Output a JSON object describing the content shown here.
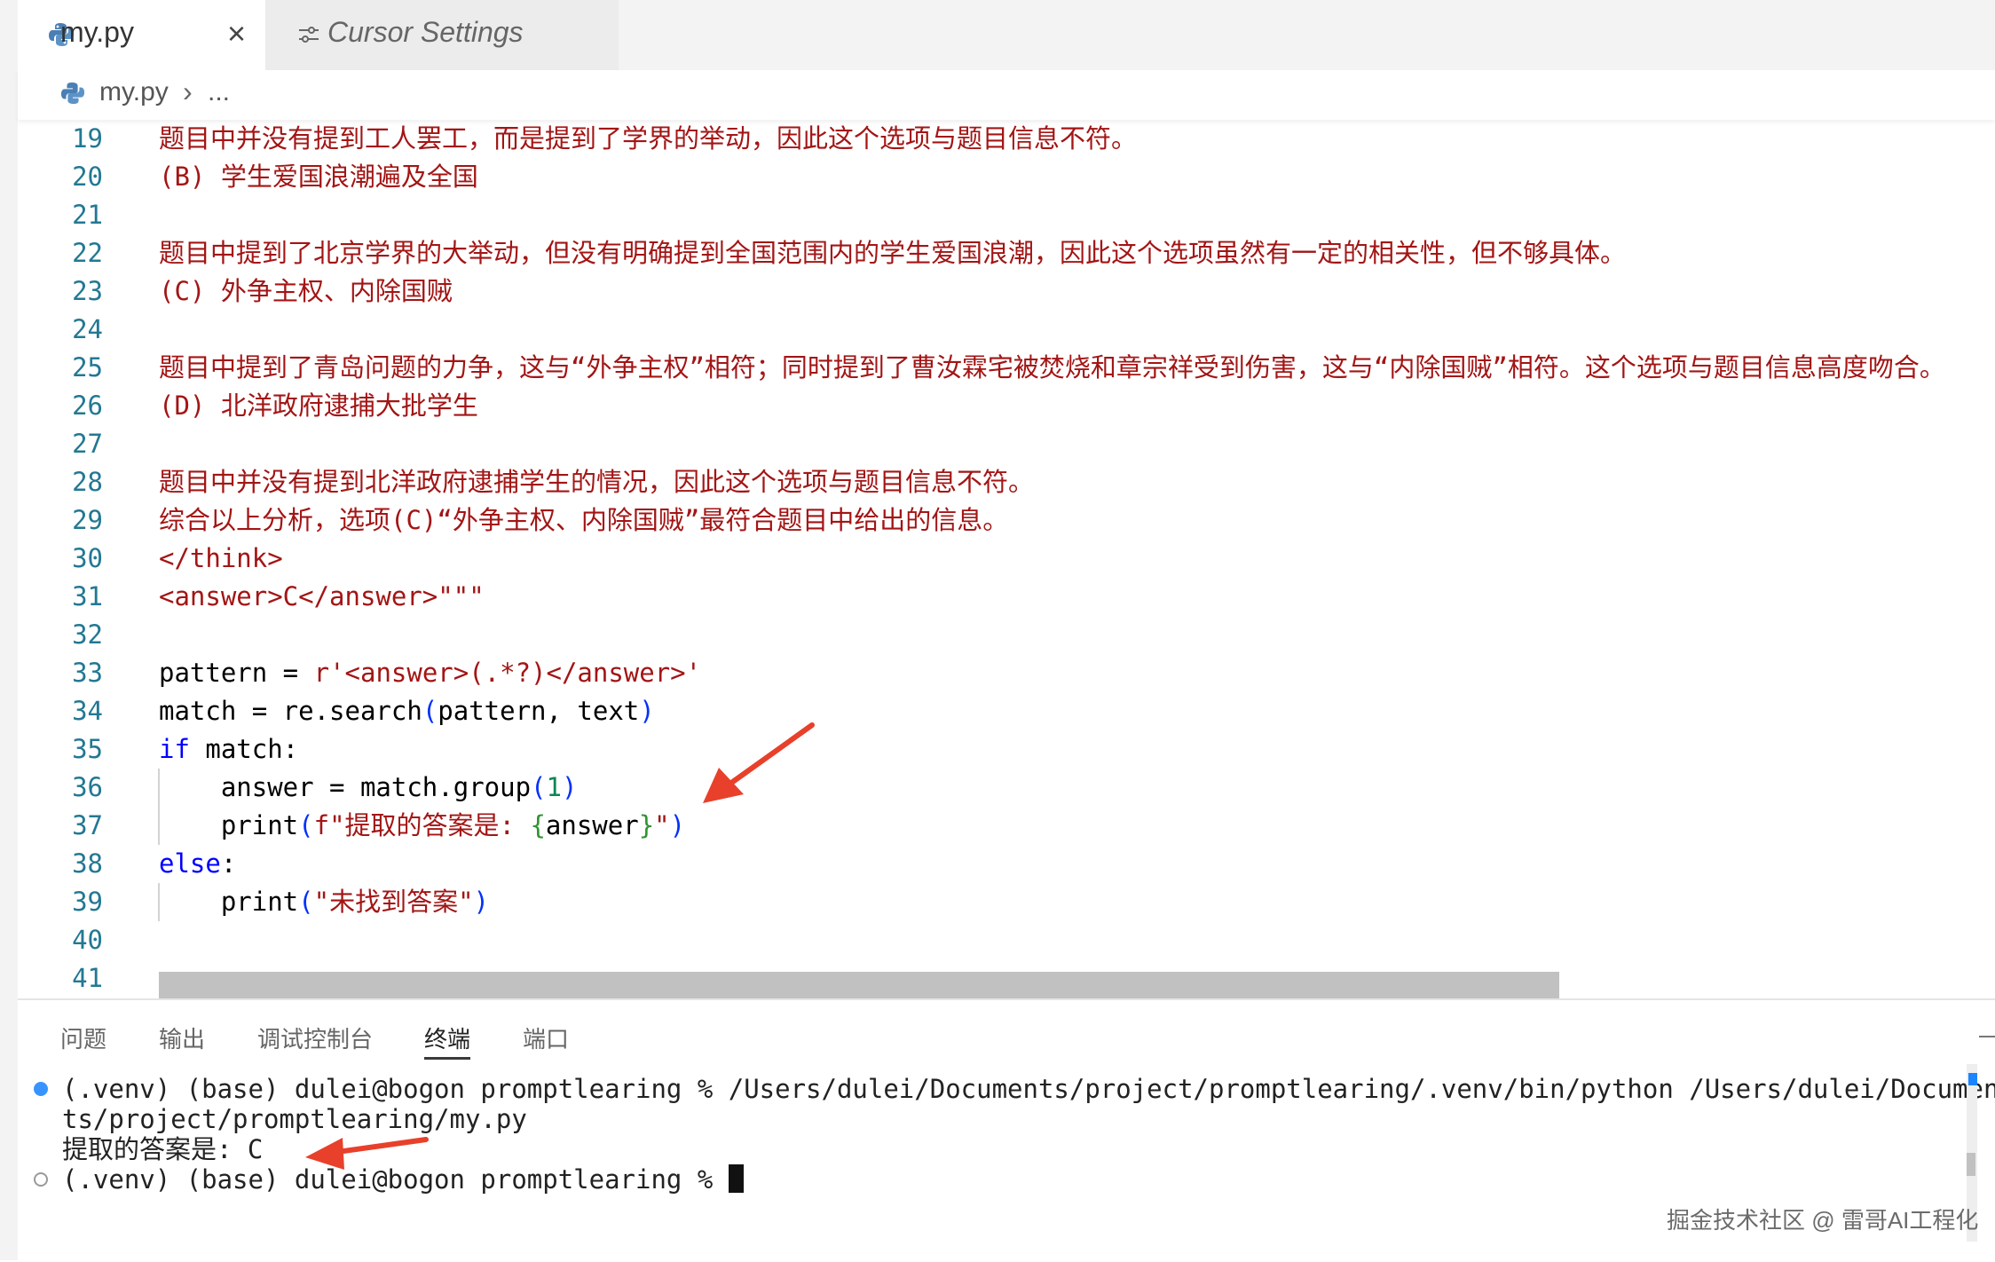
{
  "tabs": [
    {
      "label": "my.py",
      "close": "×",
      "icon": "python-icon"
    },
    {
      "label": "Cursor Settings",
      "icon": "settings-sliders-icon"
    }
  ],
  "breadcrumb": {
    "file": "my.py",
    "separator": "›",
    "more": "..."
  },
  "editor": {
    "lines": [
      {
        "n": "19"
      },
      {
        "n": "20"
      },
      {
        "n": "21"
      },
      {
        "n": "22"
      },
      {
        "n": "23"
      },
      {
        "n": "24"
      },
      {
        "n": "25"
      },
      {
        "n": "26"
      },
      {
        "n": "27"
      },
      {
        "n": "28"
      },
      {
        "n": "29"
      },
      {
        "n": "30"
      },
      {
        "n": "31"
      },
      {
        "n": "32"
      },
      {
        "n": "33"
      },
      {
        "n": "34"
      },
      {
        "n": "35"
      },
      {
        "n": "36"
      },
      {
        "n": "37"
      },
      {
        "n": "38"
      },
      {
        "n": "39"
      },
      {
        "n": "40"
      },
      {
        "n": "41"
      }
    ],
    "text": {
      "l19": "题目中并没有提到工人罢工，而是提到了学界的举动，因此这个选项与题目信息不符。",
      "l20": "(B) 学生爱国浪潮遍及全国",
      "l22": "题目中提到了北京学界的大举动，但没有明确提到全国范围内的学生爱国浪潮，因此这个选项虽然有一定的相关性，但不够具体。",
      "l23": "(C) 外争主权、内除国贼",
      "l25": "题目中提到了青岛问题的力争，这与“外争主权”相符；同时提到了曹汝霖宅被焚烧和章宗祥受到伤害，这与“内除国贼”相符。这个选项与题目信息高度吻合。",
      "l26": "(D) 北洋政府逮捕大批学生",
      "l28": "题目中并没有提到北洋政府逮捕学生的情况，因此这个选项与题目信息不符。",
      "l29": "综合以上分析，选项(C)“外争主权、内除国贼”最符合题目中给出的信息。",
      "l30": "</think>",
      "l31": "<answer>C</answer>\"\"\"",
      "l33a": "pattern",
      "l33b": " = ",
      "l33c": "r'<answer>(.*?)</answer>'",
      "l34a": "match = re.search",
      "l34b": "(",
      "l34c": "pattern, text",
      "l34d": ")",
      "l35a": "if",
      "l35b": " match:",
      "l36a": "    answer = match.group",
      "l36b": "(",
      "l36c": "1",
      "l36d": ")",
      "l37a": "    print",
      "l37b": "(",
      "l37c": "f\"提取的答案是: ",
      "l37d": "{",
      "l37e": "answer",
      "l37f": "}",
      "l37g": "\"",
      "l37h": ")",
      "l38a": "else",
      "l38b": ":",
      "l39a": "    print",
      "l39b": "(",
      "l39c": "\"未找到答案\"",
      "l39d": ")"
    }
  },
  "panel": {
    "tabs": [
      "问题",
      "输出",
      "调试控制台",
      "终端",
      "端口"
    ],
    "active_tab": "终端",
    "terminal": {
      "line1": "(.venv) (base) dulei@bogon promptlearing % /Users/dulei/Documents/project/promptlearing/.venv/bin/python /Users/dulei/Documen",
      "line2": "ts/project/promptlearing/my.py",
      "line3": "提取的答案是: C",
      "line4": "(.venv) (base) dulei@bogon promptlearing % "
    }
  },
  "watermark": "掘金技术社区 @ 雷哥AI工程化",
  "colors": {
    "string": "#a31515",
    "keyword": "#0000ff",
    "number": "#098658",
    "line_number": "#237893",
    "annotation_arrow": "#e8402a",
    "terminal_dot": "#3794ff"
  }
}
